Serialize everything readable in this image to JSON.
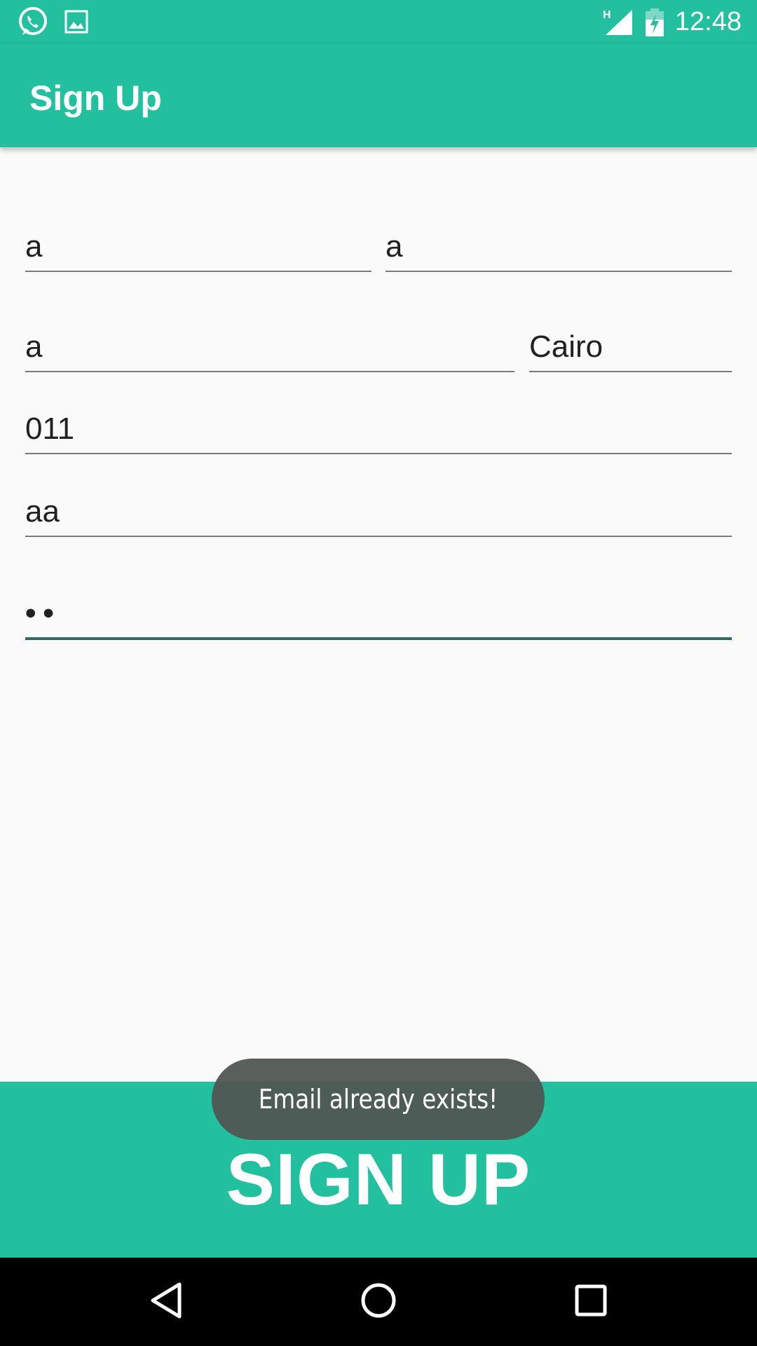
{
  "status_bar": {
    "time": "12:48",
    "network_label": "H",
    "icons": [
      "whatsapp-icon",
      "image-icon",
      "signal-icon",
      "battery-charging-icon"
    ]
  },
  "app_bar": {
    "title": "Sign Up"
  },
  "form": {
    "first_name": "a",
    "last_name": "a",
    "address": "a",
    "city": "Cairo",
    "phone": "011",
    "email": "aa",
    "password_masked": "••"
  },
  "signup_button": {
    "label": "SIGN UP"
  },
  "toast": {
    "message": "Email already exists!"
  },
  "nav_bar": {
    "icons": [
      "back-icon",
      "home-icon",
      "recents-icon"
    ]
  },
  "colors": {
    "primary": "#22c09e",
    "focused_underline": "#2e6e60",
    "toast_bg": "#505652"
  }
}
